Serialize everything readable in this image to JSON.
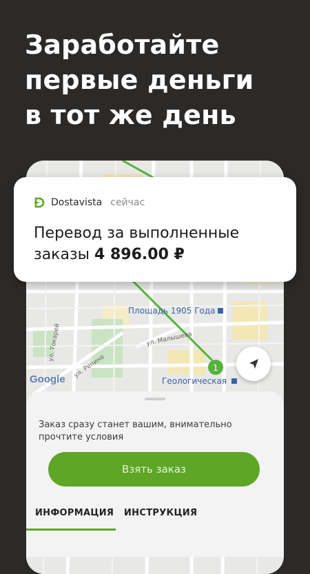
{
  "headline": {
    "line1": "Заработайте",
    "line2": "первые деньги",
    "line3": "в тот же день"
  },
  "notification": {
    "app_name": "Dostavista",
    "time": "сейчас",
    "message_line1": "Перевод за выполненные",
    "message_line2_prefix": "заказы",
    "amount": "4 896.00 ₽"
  },
  "map": {
    "google_logo": "Google",
    "labels": {
      "square": "Площадь 1905 Года",
      "malysheva": "ул. Малышева",
      "tokarey": "ул. Токарей",
      "repina": "ул. Репина",
      "geologicheskaya": "Геологическая"
    },
    "route_point_number": "1",
    "route_color": "#56b33a"
  },
  "sheet": {
    "hint_line1": "Заказ сразу станет вашим, внимательно",
    "hint_line2": "прочтите условия",
    "take_order_label": "Взять заказ",
    "tabs": [
      "ИНФОРМАЦИЯ",
      "ИНСТРУКЦИЯ"
    ]
  },
  "colors": {
    "accent": "#5ea625",
    "background": "#2c2a28"
  }
}
